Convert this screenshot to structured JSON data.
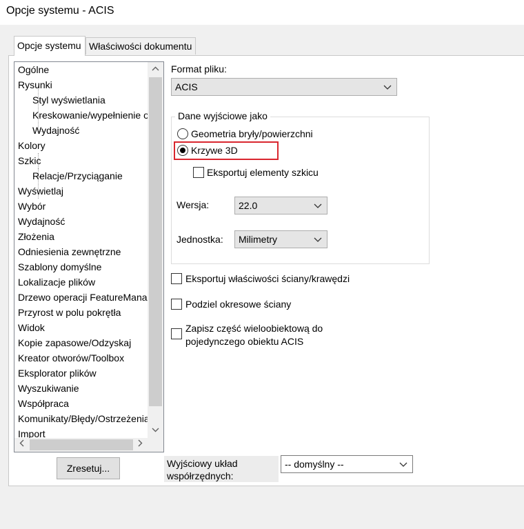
{
  "window": {
    "title": "Opcje systemu - ACIS"
  },
  "tabs": [
    {
      "label": "Opcje systemu",
      "active": true
    },
    {
      "label": "Właściwości dokumentu",
      "active": false
    }
  ],
  "tree": {
    "items": [
      {
        "label": "Ogólne",
        "level": 0
      },
      {
        "label": "Rysunki",
        "level": 0
      },
      {
        "label": "Styl wyświetlania",
        "level": 1
      },
      {
        "label": "Kreskowanie/wypełnienie obszaru",
        "level": 1
      },
      {
        "label": "Wydajność",
        "level": 1
      },
      {
        "label": "Kolory",
        "level": 0
      },
      {
        "label": "Szkic",
        "level": 0
      },
      {
        "label": "Relacje/Przyciąganie",
        "level": 1
      },
      {
        "label": "Wyświetlaj",
        "level": 0
      },
      {
        "label": "Wybór",
        "level": 0
      },
      {
        "label": "Wydajność",
        "level": 0
      },
      {
        "label": "Złożenia",
        "level": 0
      },
      {
        "label": "Odniesienia zewnętrzne",
        "level": 0
      },
      {
        "label": "Szablony domyślne",
        "level": 0
      },
      {
        "label": "Lokalizacje plików",
        "level": 0
      },
      {
        "label": "Drzewo operacji FeatureManager",
        "level": 0
      },
      {
        "label": "Przyrost w polu pokrętła",
        "level": 0
      },
      {
        "label": "Widok",
        "level": 0
      },
      {
        "label": "Kopie zapasowe/Odzyskaj",
        "level": 0
      },
      {
        "label": "Kreator otworów/Toolbox",
        "level": 0
      },
      {
        "label": "Eksplorator plików",
        "level": 0
      },
      {
        "label": "Wyszukiwanie",
        "level": 0
      },
      {
        "label": "Współpraca",
        "level": 0
      },
      {
        "label": "Komunikaty/Błędy/Ostrzeżenia",
        "level": 0
      },
      {
        "label": "Import",
        "level": 0
      }
    ]
  },
  "format": {
    "label": "Format pliku:",
    "value": "ACIS"
  },
  "output": {
    "group_label": "Dane wyjściowe jako",
    "radio_solid": {
      "label": "Geometria bryły/powierzchni",
      "checked": false
    },
    "radio_curves": {
      "label": "Krzywe 3D",
      "checked": true
    },
    "export_sketch": {
      "label": "Eksportuj elementy szkicu",
      "checked": false
    },
    "version": {
      "label": "Wersja:",
      "value": "22.0"
    },
    "unit": {
      "label": "Jednostka:",
      "value": "Milimetry"
    }
  },
  "options": {
    "export_face_props": {
      "label": "Eksportuj właściwości ściany/krawędzi",
      "checked": false
    },
    "split_periodic": {
      "label": "Podziel okresowe ściany",
      "checked": false
    },
    "save_multibody_line1": "Zapisz część wieloobiektową do",
    "save_multibody_line2": "pojedynczego obiektu ACIS"
  },
  "reset_button": "Zresetuj...",
  "coordinate": {
    "label_line1": "Wyjściowy układ",
    "label_line2": "współrzędnych:",
    "value": "-- domyślny --"
  }
}
